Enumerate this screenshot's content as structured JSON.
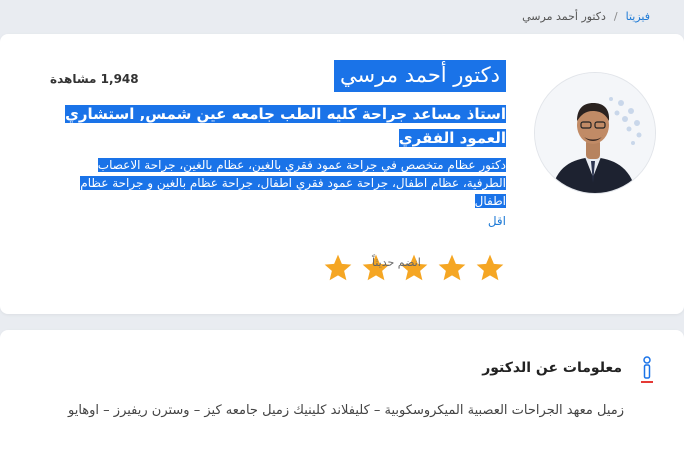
{
  "breadcrumb": {
    "home": "فيزيتا",
    "separator": "/",
    "current": "دكتور أحمد مرسي"
  },
  "profile": {
    "name": "دكتور أحمد مرسي",
    "views": "1,948 مشاهدة",
    "title": "استاذ مساعد جراحة كليه الطب جامعه عين شمس, استشاري العمود الفقري",
    "description": "دكتور عظام متخصص في جراحة عمود فقري بالغين، عظام بالغين، جراحة الاعصاب الطرفية، عظام اطفال، جراحة عمود فقري اطفال، جراحة عظام بالغين و جراحة عظام اطفال",
    "less_link": "اقل",
    "rating": {
      "stars": 5,
      "max": 5,
      "color": "#f5a623"
    },
    "joined_label": "انضم حديثاً"
  },
  "info": {
    "icon": "info-icon",
    "heading": "معلومات عن الدكتور",
    "text": "زميل معهد الجراحات العصبية الميكروسكوبية – كليفلاند كلينيك زميل جامعه كيز – وسترن ريفيرز – اوهايو"
  },
  "colors": {
    "accent": "#1a73e8",
    "link": "#1e7ad6",
    "star": "#f5a623",
    "background": "#e9ecf1"
  }
}
